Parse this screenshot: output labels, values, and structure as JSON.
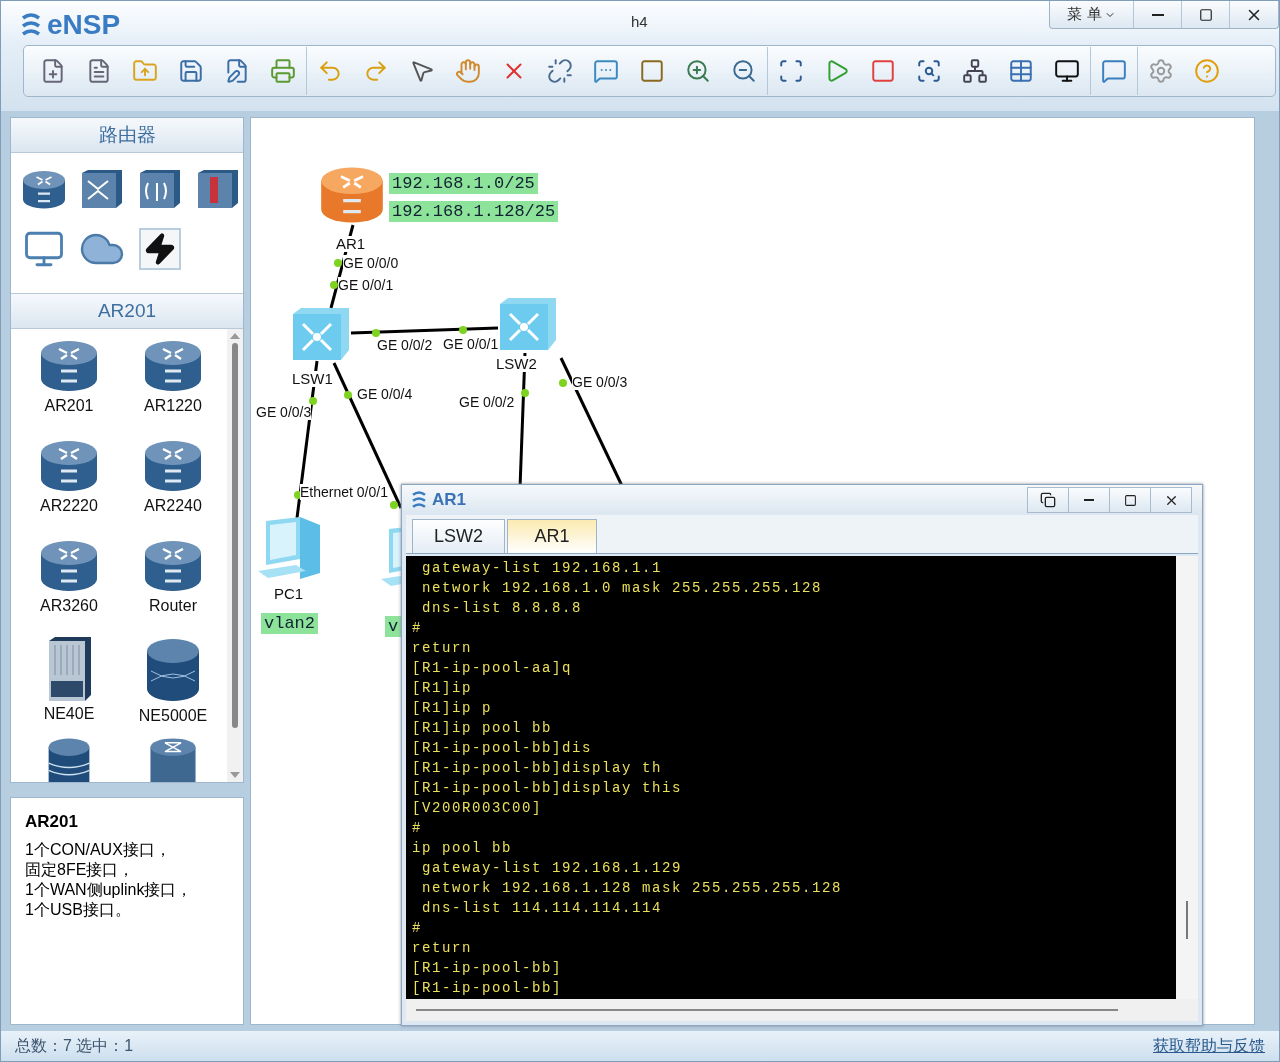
{
  "window": {
    "app_name": "eNSP",
    "title": "h4",
    "menu": "菜 单"
  },
  "sidebar": {
    "category_title": "路由器",
    "device_title": "AR201",
    "devices": [
      {
        "label": "AR201",
        "kind": "router"
      },
      {
        "label": "AR1220",
        "kind": "router"
      },
      {
        "label": "AR2220",
        "kind": "router"
      },
      {
        "label": "AR2240",
        "kind": "router"
      },
      {
        "label": "AR3260",
        "kind": "router"
      },
      {
        "label": "Router",
        "kind": "router"
      },
      {
        "label": "NE40E",
        "kind": "chassis"
      },
      {
        "label": "NE5000E",
        "kind": "core"
      },
      {
        "kind": "stack"
      },
      {
        "kind": "cx"
      }
    ],
    "description": {
      "title": "AR201",
      "lines": [
        "1个CON/AUX接口，",
        "固定8FE接口，",
        "1个WAN侧uplink接口，",
        "1个USB接口。"
      ]
    }
  },
  "topology": {
    "nodes": [
      {
        "label": "AR1",
        "kind": "router"
      },
      {
        "label": "LSW1",
        "kind": "switch"
      },
      {
        "label": "LSW2",
        "kind": "switch"
      },
      {
        "label": "PC1",
        "kind": "pc"
      },
      {
        "kind": "pc"
      }
    ],
    "notes": [
      "192.168.1.0/25",
      "192.168.1.128/25",
      "vlan2",
      "v"
    ],
    "ports": [
      "GE 0/0/0",
      "GE 0/0/1",
      "GE 0/0/2",
      "GE 0/0/1",
      "GE 0/0/3",
      "GE 0/0/4",
      "Ethernet 0/0/1",
      "GE 0/0/2",
      "GE 0/0/3"
    ]
  },
  "console": {
    "title": "AR1",
    "tabs": [
      {
        "label": "LSW2",
        "selected": false
      },
      {
        "label": "AR1",
        "selected": true
      }
    ],
    "lines": [
      " gateway-list 192.168.1.1",
      " network 192.168.1.0 mask 255.255.255.128",
      " dns-list 8.8.8.8",
      "#",
      "return",
      "[R1-ip-pool-aa]q",
      "[R1]ip",
      "[R1]ip p",
      "[R1]ip pool bb",
      "[R1-ip-pool-bb]dis",
      "[R1-ip-pool-bb]display th",
      "[R1-ip-pool-bb]display this",
      "[V200R003C00]",
      "#",
      "ip pool bb",
      " gateway-list 192.168.1.129",
      " network 192.168.1.128 mask 255.255.255.128",
      " dns-list 114.114.114.114",
      "#",
      "return",
      "[R1-ip-pool-bb]",
      "[R1-ip-pool-bb]"
    ]
  },
  "status_bar": {
    "summary": "总数：7  选中：1",
    "help_link": "获取帮助与反馈"
  }
}
